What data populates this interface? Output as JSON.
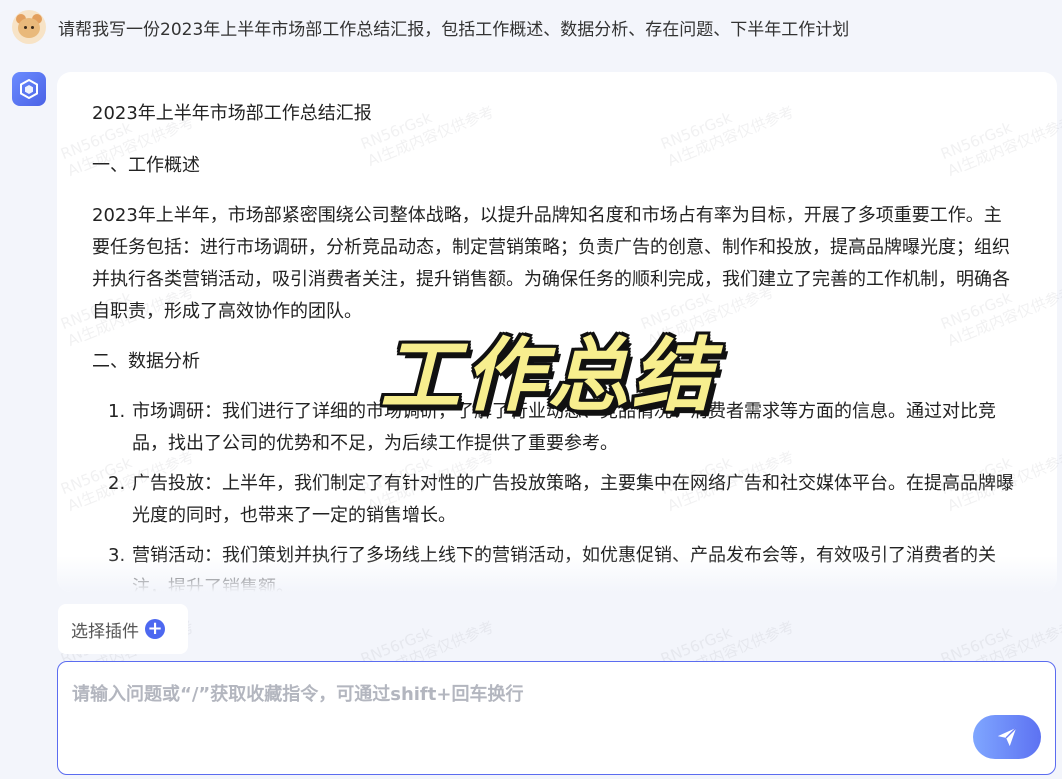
{
  "user": {
    "prompt": "请帮我写一份2023年上半年市场部工作总结汇报，包括工作概述、数据分析、存在问题、下半年工作计划"
  },
  "answer": {
    "title": "2023年上半年市场部工作总结汇报",
    "section1_heading": "一、工作概述",
    "section1_body": "2023年上半年，市场部紧密围绕公司整体战略，以提升品牌知名度和市场占有率为目标，开展了多项重要工作。主要任务包括：进行市场调研，分析竞品动态，制定营销策略；负责广告的创意、制作和投放，提高品牌曝光度；组织并执行各类营销活动，吸引消费者关注，提升销售额。为确保任务的顺利完成，我们建立了完善的工作机制，明确各自职责，形成了高效协作的团队。",
    "section2_heading": "二、数据分析",
    "list_items": [
      {
        "num": "1.",
        "text": "市场调研：我们进行了详细的市场调研，了解了行业动态、竞品情况、消费者需求等方面的信息。通过对比竞品，找出了公司的优势和不足，为后续工作提供了重要参考。"
      },
      {
        "num": "2.",
        "text": "广告投放：上半年，我们制定了有针对性的广告投放策略，主要集中在网络广告和社交媒体平台。在提高品牌曝光度的同时，也带来了一定的销售增长。"
      },
      {
        "num": "3.",
        "text": "营销活动：我们策划并执行了多场线上线下的营销活动，如优惠促销、产品发布会等，有效吸引了消费者的关注，提升了销售额。"
      }
    ]
  },
  "overlay": {
    "title": "工作总结"
  },
  "watermark": {
    "code": "RN56rGsk",
    "text": "AI生成内容仅供参考"
  },
  "plugin": {
    "label": "选择插件"
  },
  "input": {
    "placeholder": "请输入问题或“/”获取收藏指令，可通过shift+回车换行",
    "value": ""
  },
  "icons": {
    "user_avatar": "cartoon-avatar-icon",
    "bot_avatar": "cube-logo-icon",
    "plus": "plus-circle-icon",
    "send": "paper-plane-icon"
  },
  "colors": {
    "accent": "#4d68f0",
    "send_gradient_start": "#7fa6ff",
    "send_gradient_end": "#5d72f2",
    "overlay_fill": "#f7ee8e"
  }
}
